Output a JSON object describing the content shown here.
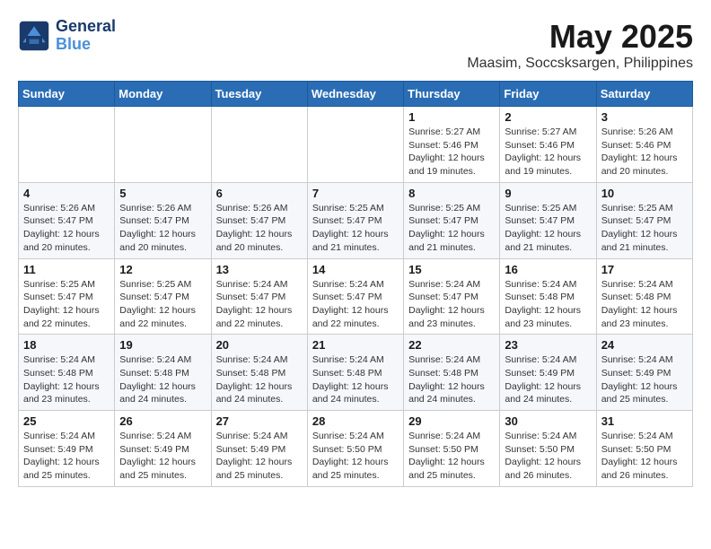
{
  "logo": {
    "text_general": "General",
    "text_blue": "Blue"
  },
  "title": "May 2025",
  "subtitle": "Maasim, Soccsksargen, Philippines",
  "headers": [
    "Sunday",
    "Monday",
    "Tuesday",
    "Wednesday",
    "Thursday",
    "Friday",
    "Saturday"
  ],
  "weeks": [
    [
      {
        "day": "",
        "info": ""
      },
      {
        "day": "",
        "info": ""
      },
      {
        "day": "",
        "info": ""
      },
      {
        "day": "",
        "info": ""
      },
      {
        "day": "1",
        "info": "Sunrise: 5:27 AM\nSunset: 5:46 PM\nDaylight: 12 hours\nand 19 minutes."
      },
      {
        "day": "2",
        "info": "Sunrise: 5:27 AM\nSunset: 5:46 PM\nDaylight: 12 hours\nand 19 minutes."
      },
      {
        "day": "3",
        "info": "Sunrise: 5:26 AM\nSunset: 5:46 PM\nDaylight: 12 hours\nand 20 minutes."
      }
    ],
    [
      {
        "day": "4",
        "info": "Sunrise: 5:26 AM\nSunset: 5:47 PM\nDaylight: 12 hours\nand 20 minutes."
      },
      {
        "day": "5",
        "info": "Sunrise: 5:26 AM\nSunset: 5:47 PM\nDaylight: 12 hours\nand 20 minutes."
      },
      {
        "day": "6",
        "info": "Sunrise: 5:26 AM\nSunset: 5:47 PM\nDaylight: 12 hours\nand 20 minutes."
      },
      {
        "day": "7",
        "info": "Sunrise: 5:25 AM\nSunset: 5:47 PM\nDaylight: 12 hours\nand 21 minutes."
      },
      {
        "day": "8",
        "info": "Sunrise: 5:25 AM\nSunset: 5:47 PM\nDaylight: 12 hours\nand 21 minutes."
      },
      {
        "day": "9",
        "info": "Sunrise: 5:25 AM\nSunset: 5:47 PM\nDaylight: 12 hours\nand 21 minutes."
      },
      {
        "day": "10",
        "info": "Sunrise: 5:25 AM\nSunset: 5:47 PM\nDaylight: 12 hours\nand 21 minutes."
      }
    ],
    [
      {
        "day": "11",
        "info": "Sunrise: 5:25 AM\nSunset: 5:47 PM\nDaylight: 12 hours\nand 22 minutes."
      },
      {
        "day": "12",
        "info": "Sunrise: 5:25 AM\nSunset: 5:47 PM\nDaylight: 12 hours\nand 22 minutes."
      },
      {
        "day": "13",
        "info": "Sunrise: 5:24 AM\nSunset: 5:47 PM\nDaylight: 12 hours\nand 22 minutes."
      },
      {
        "day": "14",
        "info": "Sunrise: 5:24 AM\nSunset: 5:47 PM\nDaylight: 12 hours\nand 22 minutes."
      },
      {
        "day": "15",
        "info": "Sunrise: 5:24 AM\nSunset: 5:47 PM\nDaylight: 12 hours\nand 23 minutes."
      },
      {
        "day": "16",
        "info": "Sunrise: 5:24 AM\nSunset: 5:48 PM\nDaylight: 12 hours\nand 23 minutes."
      },
      {
        "day": "17",
        "info": "Sunrise: 5:24 AM\nSunset: 5:48 PM\nDaylight: 12 hours\nand 23 minutes."
      }
    ],
    [
      {
        "day": "18",
        "info": "Sunrise: 5:24 AM\nSunset: 5:48 PM\nDaylight: 12 hours\nand 23 minutes."
      },
      {
        "day": "19",
        "info": "Sunrise: 5:24 AM\nSunset: 5:48 PM\nDaylight: 12 hours\nand 24 minutes."
      },
      {
        "day": "20",
        "info": "Sunrise: 5:24 AM\nSunset: 5:48 PM\nDaylight: 12 hours\nand 24 minutes."
      },
      {
        "day": "21",
        "info": "Sunrise: 5:24 AM\nSunset: 5:48 PM\nDaylight: 12 hours\nand 24 minutes."
      },
      {
        "day": "22",
        "info": "Sunrise: 5:24 AM\nSunset: 5:48 PM\nDaylight: 12 hours\nand 24 minutes."
      },
      {
        "day": "23",
        "info": "Sunrise: 5:24 AM\nSunset: 5:49 PM\nDaylight: 12 hours\nand 24 minutes."
      },
      {
        "day": "24",
        "info": "Sunrise: 5:24 AM\nSunset: 5:49 PM\nDaylight: 12 hours\nand 25 minutes."
      }
    ],
    [
      {
        "day": "25",
        "info": "Sunrise: 5:24 AM\nSunset: 5:49 PM\nDaylight: 12 hours\nand 25 minutes."
      },
      {
        "day": "26",
        "info": "Sunrise: 5:24 AM\nSunset: 5:49 PM\nDaylight: 12 hours\nand 25 minutes."
      },
      {
        "day": "27",
        "info": "Sunrise: 5:24 AM\nSunset: 5:49 PM\nDaylight: 12 hours\nand 25 minutes."
      },
      {
        "day": "28",
        "info": "Sunrise: 5:24 AM\nSunset: 5:50 PM\nDaylight: 12 hours\nand 25 minutes."
      },
      {
        "day": "29",
        "info": "Sunrise: 5:24 AM\nSunset: 5:50 PM\nDaylight: 12 hours\nand 25 minutes."
      },
      {
        "day": "30",
        "info": "Sunrise: 5:24 AM\nSunset: 5:50 PM\nDaylight: 12 hours\nand 26 minutes."
      },
      {
        "day": "31",
        "info": "Sunrise: 5:24 AM\nSunset: 5:50 PM\nDaylight: 12 hours\nand 26 minutes."
      }
    ]
  ]
}
